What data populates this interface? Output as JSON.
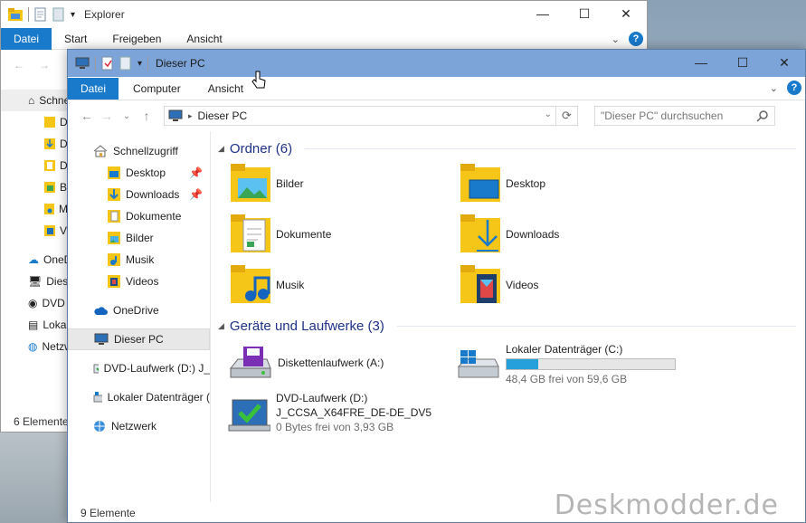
{
  "background_window": {
    "title": "Explorer",
    "tabs": [
      "Datei",
      "Start",
      "Freigeben",
      "Ansicht"
    ],
    "sidebar": [
      "Schnellzugriff",
      "D",
      "D",
      "D",
      "B",
      "M",
      "V",
      "OneDrive",
      "Dieser PC",
      "DVD",
      "Lokaler",
      "Netzwerk"
    ],
    "status": "6 Elemente"
  },
  "window": {
    "title": "Dieser PC",
    "tabs": {
      "file": "Datei",
      "computer": "Computer",
      "view": "Ansicht"
    },
    "address": "Dieser PC",
    "search_placeholder": "\"Dieser PC\" durchsuchen",
    "nav": {
      "quick_access": "Schnellzugriff",
      "desktop": "Desktop",
      "downloads": "Downloads",
      "documents": "Dokumente",
      "pictures": "Bilder",
      "music": "Musik",
      "videos": "Videos",
      "onedrive": "OneDrive",
      "this_pc": "Dieser PC",
      "dvd": "DVD-Laufwerk (D:) J_",
      "local_disk": "Lokaler Datenträger (",
      "network": "Netzwerk"
    },
    "groups": {
      "folders": "Ordner (6)",
      "devices": "Geräte und Laufwerke (3)"
    },
    "folders": {
      "pictures": "Bilder",
      "desktop": "Desktop",
      "documents": "Dokumente",
      "downloads": "Downloads",
      "music": "Musik",
      "videos": "Videos"
    },
    "drives": {
      "floppy": {
        "label": "Diskettenlaufwerk (A:)"
      },
      "local": {
        "label": "Lokaler Datenträger (C:)",
        "free": "48,4 GB frei von 59,6 GB",
        "used_fraction": 0.19
      },
      "dvd": {
        "label": "DVD-Laufwerk (D:)",
        "volume": "J_CCSA_X64FRE_DE-DE_DV5",
        "free": "0 Bytes frei von 3,93 GB"
      }
    },
    "status": "9 Elemente"
  },
  "watermark": "Deskmodder.de",
  "colors": {
    "ribbon_file": "#1979ca",
    "titlebar": "#7da4d8",
    "group_header": "#1e3287",
    "drive_bar": "#26a0da"
  }
}
